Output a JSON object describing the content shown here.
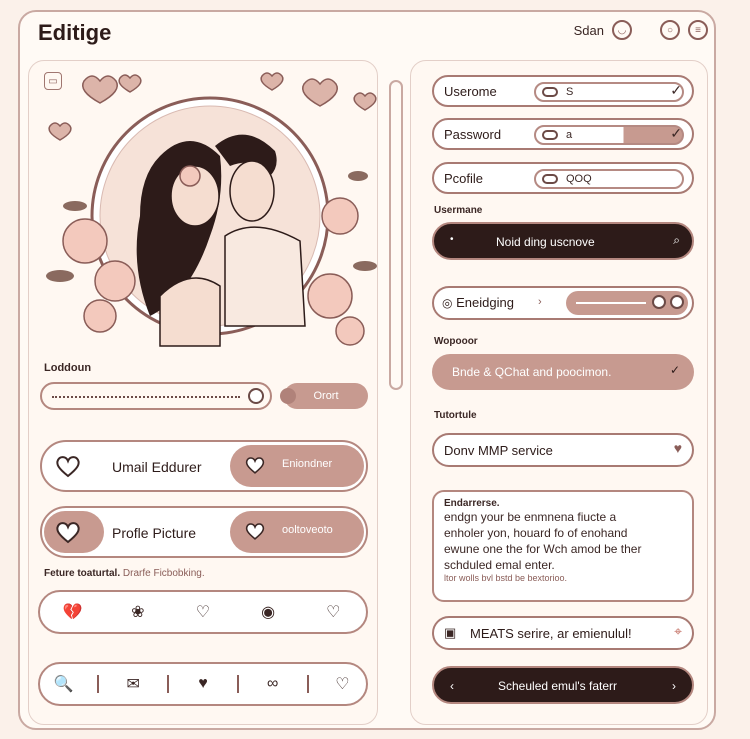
{
  "window": {
    "title": "Editige",
    "user_label": "Sdan"
  },
  "left": {
    "section_label_1": "Loddoun",
    "sort_button": "Orort",
    "row_email": {
      "label": "Umail Eddurer",
      "action": "Eniondner"
    },
    "row_profile": {
      "label": "Profle Picture",
      "action": "ooltoveoto"
    },
    "feature_label": "Feture toaturtal.",
    "feature_sublabel": "Drarfe Ficbobking."
  },
  "right": {
    "username": {
      "label": "Userome",
      "value": "S"
    },
    "password": {
      "label": "Password",
      "value": "a"
    },
    "profile": {
      "label": "Pcofile",
      "value": "QOQ"
    },
    "section_usermane": "Usermane",
    "search_pill": "Noid ding uscnove",
    "toggle_label": "Eneidging",
    "section_wopooor": "Wopooor",
    "tan_pill": "Bnde & QChat and poocimon.",
    "section_tutorial": "Tutortule",
    "service_field": "Donv MMP service",
    "textbox": {
      "header": "Endarrerse.",
      "lines": [
        "endgn  your be enmnena fiucte a",
        "enholer yon, houard fo of enohand",
        "ewune one the for Wch amod be ther",
        "schduled emal enter."
      ],
      "footnote": "ltor wolls bvl bstd be bextorioo."
    },
    "meats_field": "MEATS serire, ar emienulul!",
    "scheduled_button": "Scheuled emul's faterr"
  },
  "colors": {
    "accent": "#c79a90",
    "dark": "#2d1b19",
    "border": "#b4877f"
  }
}
